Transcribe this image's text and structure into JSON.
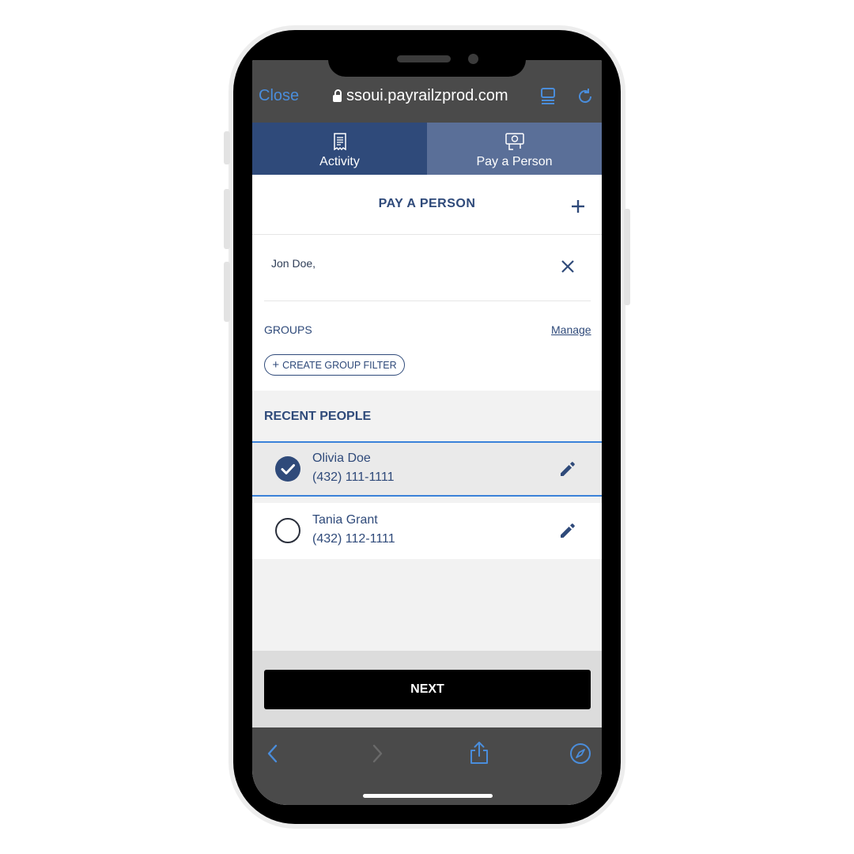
{
  "browser": {
    "close_label": "Close",
    "url": "ssoui.payrailzprod.com",
    "icons": [
      "lock-icon",
      "reader-icon",
      "reload-icon",
      "back-icon",
      "forward-icon",
      "share-icon",
      "compass-icon"
    ],
    "accent_color": "#4a8ddb"
  },
  "tabs": [
    {
      "label": "Activity",
      "icon": "receipt-icon",
      "active": false
    },
    {
      "label": "Pay a Person",
      "icon": "money-send-icon",
      "active": true
    }
  ],
  "page": {
    "title": "PAY A PERSON",
    "recipient_text": "Jon Doe,",
    "groups_label": "GROUPS",
    "manage_label": "Manage",
    "create_group_label": "CREATE GROUP FILTER",
    "recent_header": "RECENT PEOPLE",
    "people": [
      {
        "name": "Olivia Doe",
        "phone": "(432) 111-1111",
        "selected": true
      },
      {
        "name": "Tania Grant",
        "phone": "(432) 112-1111",
        "selected": false
      }
    ],
    "next_label": "NEXT"
  },
  "colors": {
    "brand_navy": "#2f4a7a",
    "tab_inactive": "#5a6f98",
    "selection_border": "#3b82d9"
  }
}
